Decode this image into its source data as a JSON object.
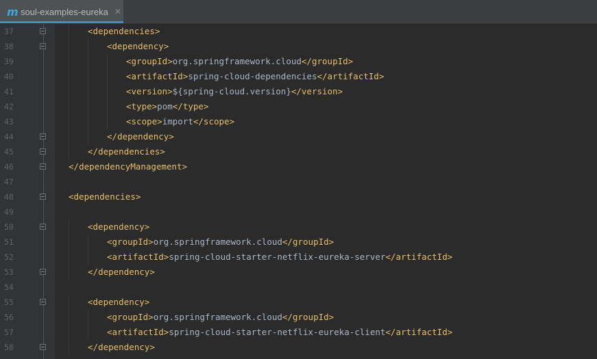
{
  "tab": {
    "icon": "maven-icon",
    "icon_glyph": "m",
    "label": "soul-examples-eureka",
    "close_glyph": "✕"
  },
  "colors": {
    "tag": "#e8bf6a",
    "text": "#a9b7c6",
    "line_number": "#606366",
    "background": "#2b2b2b"
  },
  "lines": [
    {
      "n": "37",
      "indent": 1,
      "fold": true,
      "parts": [
        {
          "t": "<",
          "c": "br"
        },
        {
          "t": "dependencies",
          "c": "tag"
        },
        {
          "t": ">",
          "c": "br"
        }
      ]
    },
    {
      "n": "38",
      "indent": 2,
      "fold": true,
      "parts": [
        {
          "t": "<",
          "c": "br"
        },
        {
          "t": "dependency",
          "c": "tag"
        },
        {
          "t": ">",
          "c": "br"
        }
      ]
    },
    {
      "n": "39",
      "indent": 3,
      "fold": false,
      "parts": [
        {
          "t": "<",
          "c": "br"
        },
        {
          "t": "groupId",
          "c": "tag"
        },
        {
          "t": ">",
          "c": "br"
        },
        {
          "t": "org.springframework.cloud",
          "c": "txt"
        },
        {
          "t": "</",
          "c": "br"
        },
        {
          "t": "groupId",
          "c": "tag"
        },
        {
          "t": ">",
          "c": "br"
        }
      ]
    },
    {
      "n": "40",
      "indent": 3,
      "fold": false,
      "parts": [
        {
          "t": "<",
          "c": "br"
        },
        {
          "t": "artifactId",
          "c": "tag"
        },
        {
          "t": ">",
          "c": "br"
        },
        {
          "t": "spring-cloud-dependencies",
          "c": "txt"
        },
        {
          "t": "</",
          "c": "br"
        },
        {
          "t": "artifactId",
          "c": "tag"
        },
        {
          "t": ">",
          "c": "br"
        }
      ]
    },
    {
      "n": "41",
      "indent": 3,
      "fold": false,
      "parts": [
        {
          "t": "<",
          "c": "br"
        },
        {
          "t": "version",
          "c": "tag"
        },
        {
          "t": ">",
          "c": "br"
        },
        {
          "t": "${spring-cloud.version}",
          "c": "txt"
        },
        {
          "t": "</",
          "c": "br"
        },
        {
          "t": "version",
          "c": "tag"
        },
        {
          "t": ">",
          "c": "br"
        }
      ]
    },
    {
      "n": "42",
      "indent": 3,
      "fold": false,
      "parts": [
        {
          "t": "<",
          "c": "br"
        },
        {
          "t": "type",
          "c": "tag"
        },
        {
          "t": ">",
          "c": "br"
        },
        {
          "t": "pom",
          "c": "txt"
        },
        {
          "t": "</",
          "c": "br"
        },
        {
          "t": "type",
          "c": "tag"
        },
        {
          "t": ">",
          "c": "br"
        }
      ]
    },
    {
      "n": "43",
      "indent": 3,
      "fold": false,
      "parts": [
        {
          "t": "<",
          "c": "br"
        },
        {
          "t": "scope",
          "c": "tag"
        },
        {
          "t": ">",
          "c": "br"
        },
        {
          "t": "import",
          "c": "txt"
        },
        {
          "t": "</",
          "c": "br"
        },
        {
          "t": "scope",
          "c": "tag"
        },
        {
          "t": ">",
          "c": "br"
        }
      ]
    },
    {
      "n": "44",
      "indent": 2,
      "fold": true,
      "parts": [
        {
          "t": "</",
          "c": "br"
        },
        {
          "t": "dependency",
          "c": "tag"
        },
        {
          "t": ">",
          "c": "br"
        }
      ]
    },
    {
      "n": "45",
      "indent": 1,
      "fold": true,
      "parts": [
        {
          "t": "</",
          "c": "br"
        },
        {
          "t": "dependencies",
          "c": "tag"
        },
        {
          "t": ">",
          "c": "br"
        }
      ]
    },
    {
      "n": "46",
      "indent": 0,
      "fold": true,
      "parts": [
        {
          "t": "</",
          "c": "br"
        },
        {
          "t": "dependencyManagement",
          "c": "tag"
        },
        {
          "t": ">",
          "c": "br"
        }
      ]
    },
    {
      "n": "47",
      "indent": 0,
      "fold": false,
      "parts": []
    },
    {
      "n": "48",
      "indent": 0,
      "fold": true,
      "parts": [
        {
          "t": "<",
          "c": "br"
        },
        {
          "t": "dependencies",
          "c": "tag"
        },
        {
          "t": ">",
          "c": "br"
        }
      ]
    },
    {
      "n": "49",
      "indent": 0,
      "fold": false,
      "parts": []
    },
    {
      "n": "50",
      "indent": 1,
      "fold": true,
      "parts": [
        {
          "t": "<",
          "c": "br"
        },
        {
          "t": "dependency",
          "c": "tag"
        },
        {
          "t": ">",
          "c": "br"
        }
      ]
    },
    {
      "n": "51",
      "indent": 2,
      "fold": false,
      "parts": [
        {
          "t": "<",
          "c": "br"
        },
        {
          "t": "groupId",
          "c": "tag"
        },
        {
          "t": ">",
          "c": "br"
        },
        {
          "t": "org.springframework.cloud",
          "c": "txt"
        },
        {
          "t": "</",
          "c": "br"
        },
        {
          "t": "groupId",
          "c": "tag"
        },
        {
          "t": ">",
          "c": "br"
        }
      ]
    },
    {
      "n": "52",
      "indent": 2,
      "fold": false,
      "parts": [
        {
          "t": "<",
          "c": "br"
        },
        {
          "t": "artifactId",
          "c": "tag"
        },
        {
          "t": ">",
          "c": "br"
        },
        {
          "t": "spring-cloud-starter-netflix-eureka-server",
          "c": "txt"
        },
        {
          "t": "</",
          "c": "br"
        },
        {
          "t": "artifactId",
          "c": "tag"
        },
        {
          "t": ">",
          "c": "br"
        }
      ]
    },
    {
      "n": "53",
      "indent": 1,
      "fold": true,
      "parts": [
        {
          "t": "</",
          "c": "br"
        },
        {
          "t": "dependency",
          "c": "tag"
        },
        {
          "t": ">",
          "c": "br"
        }
      ]
    },
    {
      "n": "54",
      "indent": 0,
      "fold": false,
      "parts": []
    },
    {
      "n": "55",
      "indent": 1,
      "fold": true,
      "parts": [
        {
          "t": "<",
          "c": "br"
        },
        {
          "t": "dependency",
          "c": "tag"
        },
        {
          "t": ">",
          "c": "br"
        }
      ]
    },
    {
      "n": "56",
      "indent": 2,
      "fold": false,
      "parts": [
        {
          "t": "<",
          "c": "br"
        },
        {
          "t": "groupId",
          "c": "tag"
        },
        {
          "t": ">",
          "c": "br"
        },
        {
          "t": "org.springframework.cloud",
          "c": "txt"
        },
        {
          "t": "</",
          "c": "br"
        },
        {
          "t": "groupId",
          "c": "tag"
        },
        {
          "t": ">",
          "c": "br"
        }
      ]
    },
    {
      "n": "57",
      "indent": 2,
      "fold": false,
      "parts": [
        {
          "t": "<",
          "c": "br"
        },
        {
          "t": "artifactId",
          "c": "tag"
        },
        {
          "t": ">",
          "c": "br"
        },
        {
          "t": "spring-cloud-starter-netflix-eureka-client",
          "c": "txt"
        },
        {
          "t": "</",
          "c": "br"
        },
        {
          "t": "artifactId",
          "c": "tag"
        },
        {
          "t": ">",
          "c": "br"
        }
      ]
    },
    {
      "n": "58",
      "indent": 1,
      "fold": true,
      "parts": [
        {
          "t": "</",
          "c": "br"
        },
        {
          "t": "dependency",
          "c": "tag"
        },
        {
          "t": ">",
          "c": "br"
        }
      ]
    }
  ]
}
